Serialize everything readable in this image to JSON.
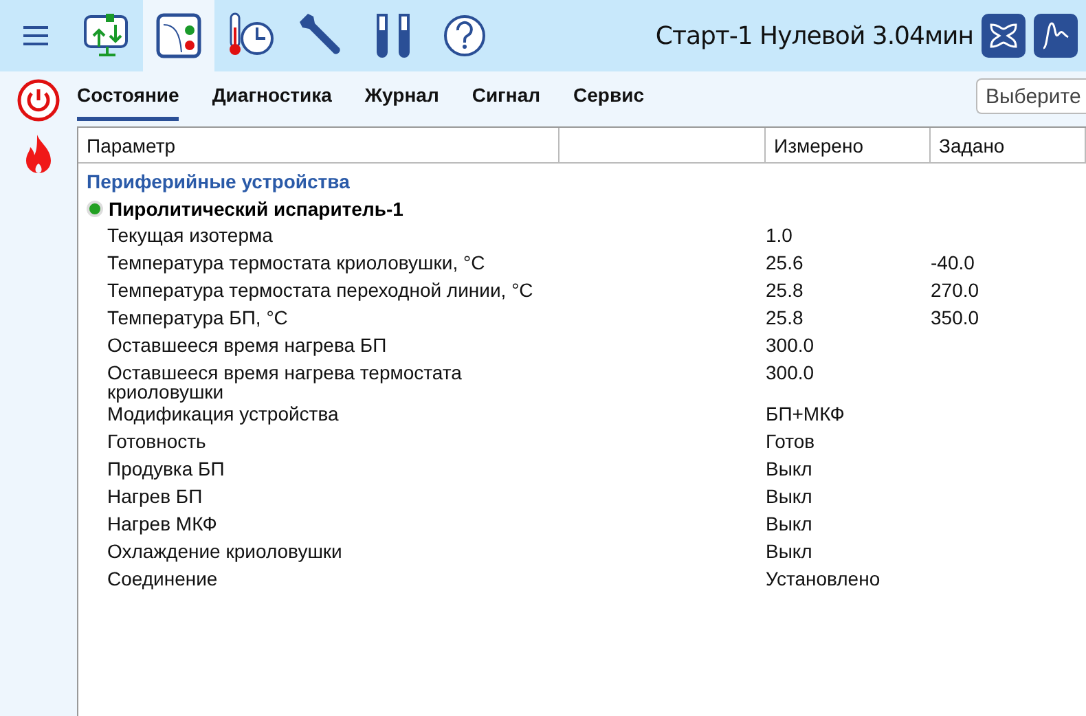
{
  "toolbar": {
    "items": [
      {
        "kind": "menu",
        "selected": false
      },
      {
        "kind": "transfer",
        "selected": false
      },
      {
        "kind": "chromatogram",
        "selected": true
      },
      {
        "kind": "thermo",
        "selected": false
      },
      {
        "kind": "wrench",
        "selected": false
      },
      {
        "kind": "tubes",
        "selected": false
      },
      {
        "kind": "help",
        "selected": false
      }
    ],
    "status": "Старт-1 Нулевой 3.04мин",
    "right_buttons": [
      {
        "kind": "butterfly"
      },
      {
        "kind": "peak"
      }
    ]
  },
  "side": [
    {
      "kind": "power"
    },
    {
      "kind": "flame"
    }
  ],
  "tabs": [
    {
      "label": "Состояние",
      "selected": true
    },
    {
      "label": "Диагностика",
      "selected": false
    },
    {
      "label": "Журнал",
      "selected": false
    },
    {
      "label": "Сигнал",
      "selected": false
    },
    {
      "label": "Сервис",
      "selected": false
    }
  ],
  "select": {
    "placeholder": "Выберите"
  },
  "table": {
    "columns": [
      "Параметр",
      "",
      "Измерено",
      "Задано"
    ],
    "group": "Периферийные устройства",
    "device": {
      "name": "Пиролитический испаритель-1",
      "color": "#22a022"
    },
    "rows": [
      {
        "name": "Текущая изотерма",
        "measured": "1.0",
        "set": ""
      },
      {
        "name": "Температура термостата криоловушки, °C",
        "measured": "25.6",
        "set": "-40.0"
      },
      {
        "name": "Температура термостата переходной линии, °C",
        "measured": "25.8",
        "set": "270.0"
      },
      {
        "name": "Температура БП, °C",
        "measured": "25.8",
        "set": "350.0"
      },
      {
        "name": "Оставшееся время нагрева БП",
        "measured": "300.0",
        "set": ""
      },
      {
        "name": "Оставшееся время нагрева термостата криоловушки",
        "measured": "300.0",
        "set": ""
      },
      {
        "name": "Модификация устройства",
        "measured": "БП+МКФ",
        "set": ""
      },
      {
        "name": "Готовность",
        "measured": "Готов",
        "set": ""
      },
      {
        "name": "Продувка БП",
        "measured": "Выкл",
        "set": ""
      },
      {
        "name": "Нагрев БП",
        "measured": "Выкл",
        "set": ""
      },
      {
        "name": "Нагрев МКФ",
        "measured": "Выкл",
        "set": ""
      },
      {
        "name": "Охлаждение криоловушки",
        "measured": "Выкл",
        "set": ""
      },
      {
        "name": "Соединение",
        "measured": "Установлено",
        "set": ""
      }
    ]
  }
}
